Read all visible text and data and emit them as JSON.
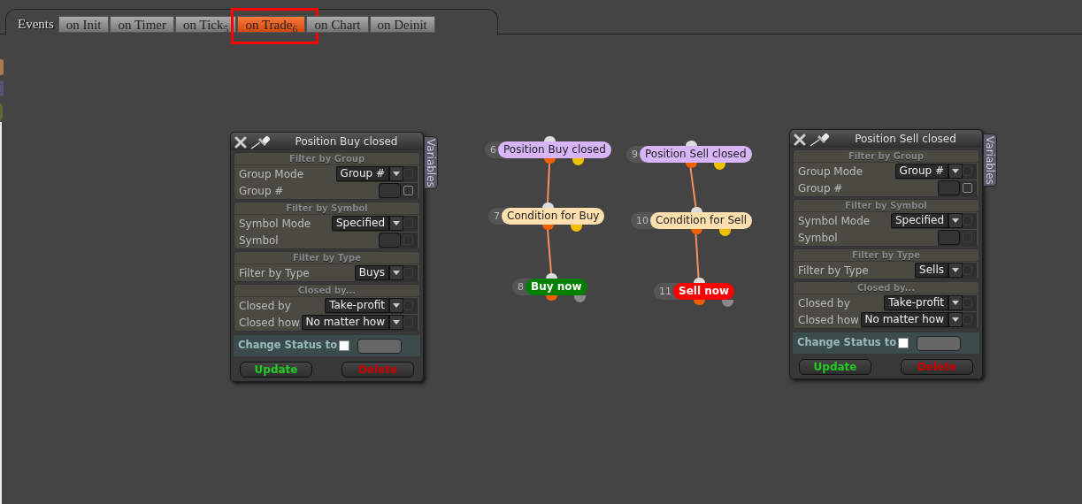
{
  "events_label": "Events",
  "tabs": [
    {
      "label": "on Init",
      "selected": false,
      "highlighted": false
    },
    {
      "label": "on Timer",
      "selected": false,
      "highlighted": false
    },
    {
      "label": "on Tick",
      "badge": "5",
      "selected": false,
      "highlighted": false
    },
    {
      "label": "on Trade",
      "badge": "6",
      "selected": true,
      "highlighted": true
    },
    {
      "label": "on Chart",
      "selected": false,
      "highlighted": false
    },
    {
      "label": "on Deinit",
      "selected": false,
      "highlighted": false
    }
  ],
  "panels": [
    {
      "title": "Position Buy closed",
      "side_tab": "Variables",
      "sections": [
        {
          "title": "Filter by Group",
          "rows": [
            {
              "label": "Group Mode",
              "kind": "select",
              "value": "Group #",
              "checked": false,
              "disabled": true
            },
            {
              "label": "Group #",
              "kind": "input",
              "checked": false,
              "disabled": false
            }
          ]
        },
        {
          "title": "Filter by Symbol",
          "rows": [
            {
              "label": "Symbol Mode",
              "kind": "select",
              "value": "Specified",
              "checked": false,
              "disabled": true
            },
            {
              "label": "Symbol",
              "kind": "input",
              "checked": false,
              "disabled": true
            }
          ]
        },
        {
          "title": "Filter by Type",
          "rows": [
            {
              "label": "Filter by Type",
              "kind": "select",
              "value": "Buys",
              "checked": false,
              "disabled": true
            }
          ]
        },
        {
          "title": "Closed by...",
          "rows": [
            {
              "label": "Closed by",
              "kind": "select",
              "value": "Take-profit",
              "checked": false,
              "disabled": true
            },
            {
              "label": "Closed how",
              "kind": "select",
              "value": "No matter how",
              "checked": false,
              "disabled": true
            }
          ]
        }
      ],
      "status": {
        "label": "Change Status to",
        "checked": false
      },
      "buttons": [
        {
          "label": "Update",
          "kind": "update"
        },
        {
          "label": "Delete",
          "kind": "delete"
        }
      ]
    },
    {
      "title": "Position Sell closed",
      "side_tab": "Variables",
      "sections": [
        {
          "title": "Filter by Group",
          "rows": [
            {
              "label": "Group Mode",
              "kind": "select",
              "value": "Group #",
              "checked": false,
              "disabled": true
            },
            {
              "label": "Group #",
              "kind": "input",
              "checked": false,
              "disabled": false
            }
          ]
        },
        {
          "title": "Filter by Symbol",
          "rows": [
            {
              "label": "Symbol Mode",
              "kind": "select",
              "value": "Specified",
              "checked": false,
              "disabled": true
            },
            {
              "label": "Symbol",
              "kind": "input",
              "checked": false,
              "disabled": true
            }
          ]
        },
        {
          "title": "Filter by Type",
          "rows": [
            {
              "label": "Filter by Type",
              "kind": "select",
              "value": "Sells",
              "checked": false,
              "disabled": true
            }
          ]
        },
        {
          "title": "Closed by...",
          "rows": [
            {
              "label": "Closed by",
              "kind": "select",
              "value": "Take-profit",
              "checked": false,
              "disabled": true
            },
            {
              "label": "Closed how",
              "kind": "select",
              "value": "No matter how",
              "checked": false,
              "disabled": true
            }
          ]
        }
      ],
      "status": {
        "label": "Change Status to",
        "checked": false
      },
      "buttons": [
        {
          "label": "Update",
          "kind": "update"
        },
        {
          "label": "Delete",
          "kind": "delete"
        }
      ]
    }
  ],
  "flows": [
    [
      {
        "number": "6",
        "label": "Position Buy closed",
        "color": "#d8b4f8",
        "kind": "event"
      },
      {
        "number": "7",
        "label": "Condition for Buy",
        "color": "#ffdfae",
        "kind": "condition"
      },
      {
        "number": "8",
        "label": "Buy now",
        "color": "#008000",
        "kind": "action"
      }
    ],
    [
      {
        "number": "9",
        "label": "Position Sell closed",
        "color": "#d8b4f8",
        "kind": "event"
      },
      {
        "number": "10",
        "label": "Condition for Sell",
        "color": "#ffdfae",
        "kind": "condition"
      },
      {
        "number": "11",
        "label": "Sell now",
        "color": "#ff0000",
        "kind": "action"
      }
    ]
  ]
}
